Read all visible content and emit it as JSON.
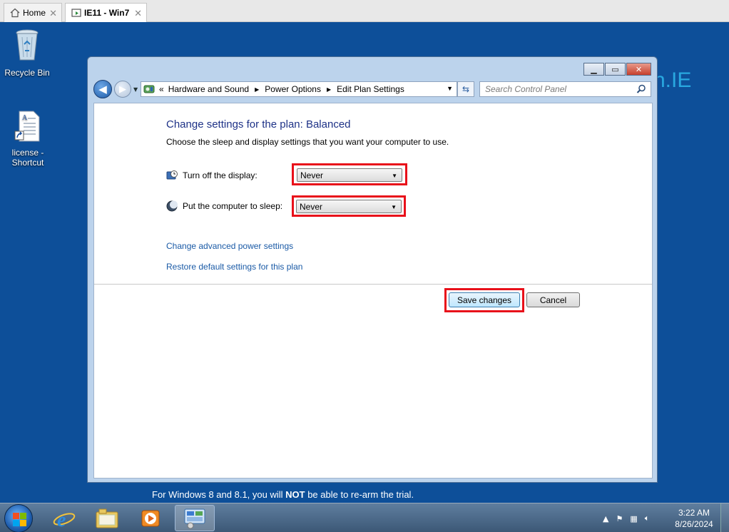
{
  "host_tabs": [
    {
      "label": "Home"
    },
    {
      "label": "IE11 - Win7"
    }
  ],
  "desktop": {
    "watermark": "n.IE",
    "icons": [
      {
        "label": "Recycle Bin"
      },
      {
        "label": "license - Shortcut"
      }
    ],
    "trial_note_before": "For Windows 8 and 8.1, you will ",
    "trial_note_bold": "NOT",
    "trial_note_after": " be able to re-arm the trial."
  },
  "window": {
    "breadcrumb": [
      "Hardware and Sound",
      "Power Options",
      "Edit Plan Settings"
    ],
    "search_placeholder": "Search Control Panel",
    "heading": "Change settings for the plan: Balanced",
    "subheading": "Choose the sleep and display settings that you want your computer to use.",
    "settings": [
      {
        "label": "Turn off the display:",
        "value": "Never"
      },
      {
        "label": "Put the computer to sleep:",
        "value": "Never"
      }
    ],
    "links": [
      "Change advanced power settings",
      "Restore default settings for this plan"
    ],
    "save_label": "Save changes",
    "cancel_label": "Cancel"
  },
  "taskbar": {
    "time": "3:22 AM",
    "date": "8/26/2024"
  },
  "colors": {
    "highlight": "#e8101a",
    "desktop": "#0d4f99",
    "heading": "#1e3287",
    "link": "#1a5aa6"
  }
}
